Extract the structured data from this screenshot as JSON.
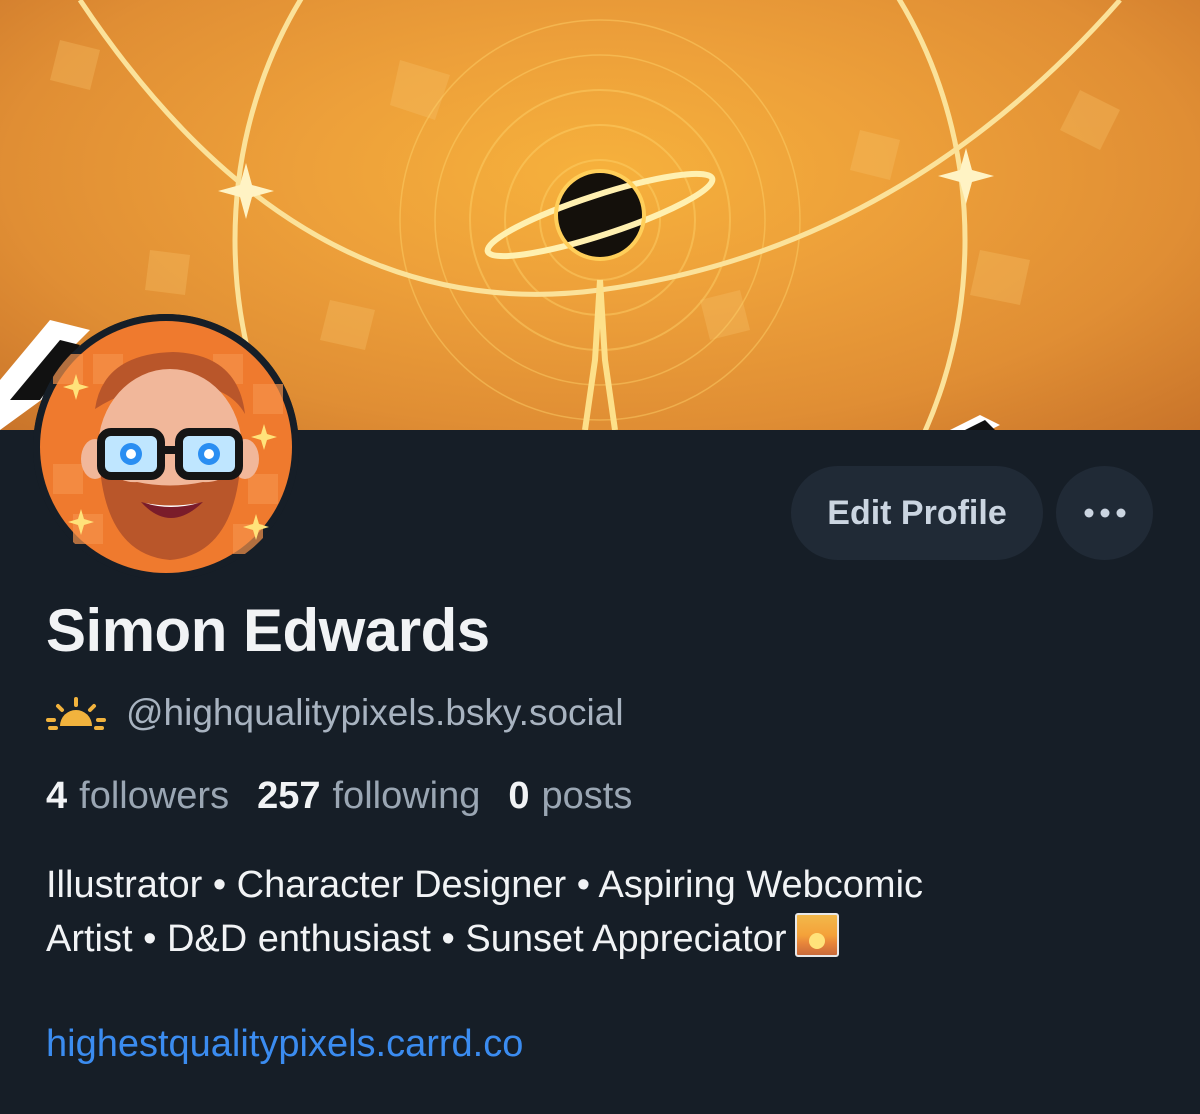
{
  "profile": {
    "name": "Simon Edwards",
    "handle": "@highqualitypixels.bsky.social",
    "stats": [
      {
        "count": "4",
        "label": "followers"
      },
      {
        "count": "257",
        "label": "following"
      },
      {
        "count": "0",
        "label": "posts"
      }
    ],
    "bio_lines": [
      "Illustrator • Character Designer • Aspiring Webcomic",
      "Artist • D&D enthusiast • Sunset Appreciator"
    ],
    "link": "highestqualitypixels.carrd.co"
  },
  "actions": {
    "edit_label": "Edit Profile",
    "more_label": "•••"
  },
  "icons": {
    "handle_icon": "sun-icon",
    "bio_emoji": "sunset-emoji-icon",
    "more": "ellipsis-icon"
  },
  "colors": {
    "background": "#161e27",
    "button_bg": "#202a36",
    "link": "#3b8cf0",
    "banner": "#eda03a"
  }
}
